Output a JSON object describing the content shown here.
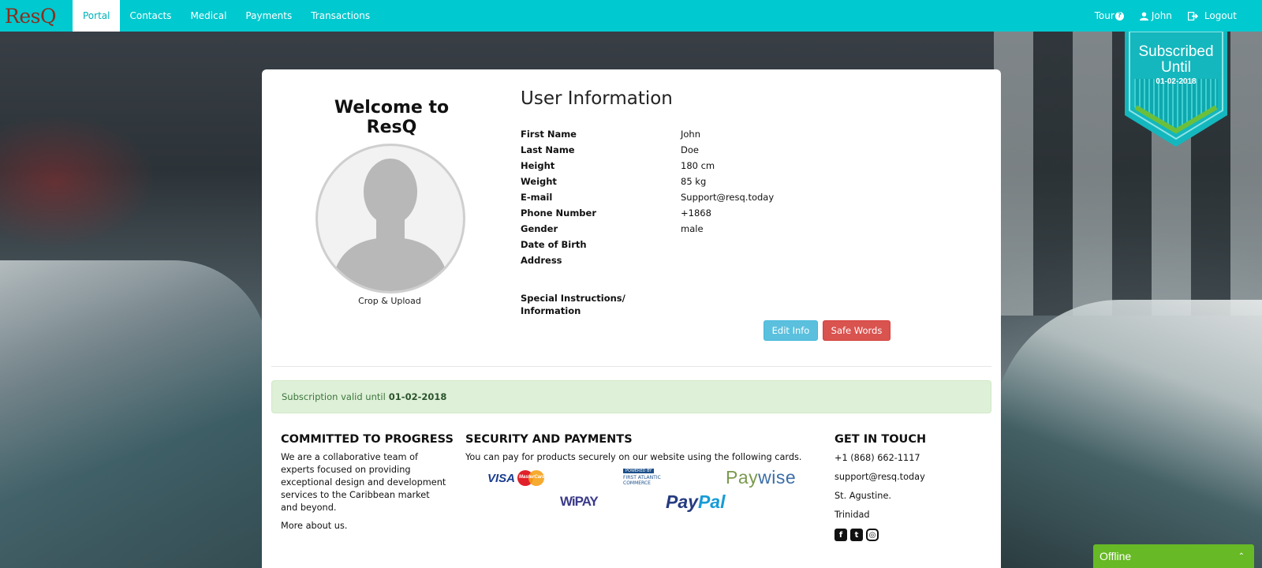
{
  "nav": {
    "brand": "ResQ",
    "items": [
      {
        "label": "Portal",
        "active": true
      },
      {
        "label": "Contacts"
      },
      {
        "label": "Medical"
      },
      {
        "label": "Payments"
      },
      {
        "label": "Transactions"
      }
    ],
    "tour": "Tour",
    "user": "John",
    "logout": "Logout"
  },
  "badge": {
    "title": "Subscribed Until",
    "date": "01-02-2018"
  },
  "profile": {
    "welcome": "Welcome to ResQ",
    "crop_link": "Crop & Upload"
  },
  "user_info": {
    "title": "User Information",
    "rows": [
      {
        "label": "First Name",
        "value": "John"
      },
      {
        "label": "Last Name",
        "value": "Doe"
      },
      {
        "label": "Height",
        "value": "180 cm"
      },
      {
        "label": "Weight",
        "value": "85 kg"
      },
      {
        "label": "E-mail",
        "value": "Support@resq.today"
      },
      {
        "label": "Phone Number",
        "value": "+1868"
      },
      {
        "label": "Gender",
        "value": "male"
      },
      {
        "label": "Date of Birth",
        "value": ""
      },
      {
        "label": "Address",
        "value": ""
      }
    ],
    "special_label": "Special Instructions/ Information",
    "edit_button": "Edit Info",
    "safe_words_button": "Safe Words"
  },
  "subscription": {
    "text": "Subscription valid until",
    "date": "01-02-2018"
  },
  "footer": {
    "progress_title": "COMMITTED TO PROGRESS",
    "progress_text": "We are a collaborative team of experts focused on providing exceptional design and development services to the Caribbean market and beyond.",
    "more_link": "More about us.",
    "security_title": "SECURITY AND PAYMENTS",
    "security_text": "You can pay for products securely on our website using the following cards.",
    "logos": {
      "visa": "VISA",
      "mastercard": "MasterCard",
      "fac_top": "POWERED BY",
      "fac_name": "FIRST ATLANTIC COMMERCE",
      "paywise_a": "Pay",
      "paywise_b": "wise",
      "wipay": "WiPAY",
      "paypal_a": "Pay",
      "paypal_b": "Pal"
    },
    "contact_title": "GET IN TOUCH",
    "phone": "+1 (868) 662-1117",
    "email": "support@resq.today",
    "city": "St. Agustine.",
    "country": "Trinidad"
  },
  "chat": {
    "status": "Offline"
  },
  "colors": {
    "navbar": "#00c9cf",
    "edit_button": "#5bc0de",
    "safe_words_button": "#d9534f",
    "alert_bg": "#dff0d8",
    "offline": "#67b925"
  }
}
